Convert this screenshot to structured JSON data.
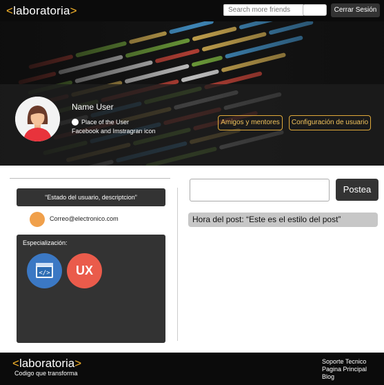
{
  "header": {
    "logo_open": "<",
    "logo_text": "laboratoria",
    "logo_close": ">",
    "search_placeholder": "Search more friends",
    "logout_label": "Cerrar Sesión"
  },
  "profile": {
    "name": "Name User",
    "place": "Place of the User",
    "social": "Facebook and Imstragran icon",
    "friends_button": "Amigos y mentores",
    "settings_button": "Configuración de usuario"
  },
  "sidebar": {
    "status": "“Estado del usuario, descriptcion”",
    "email": "Correo@electronico.com",
    "specialization_title": "Especialización:",
    "specializations": [
      "code-icon",
      "ux-icon"
    ],
    "ux_label": "UX"
  },
  "feed": {
    "post_button": "Postea",
    "post_text": "Hora del post: “Este es el estilo del post”"
  },
  "footer": {
    "logo_open": "<",
    "logo_text": "laboratoria",
    "logo_close": ">",
    "tagline": "Codigo que transforma",
    "links": [
      "Soporte Tecnico",
      "Pagina Principal",
      "Blog"
    ]
  },
  "colors": {
    "accent": "#f7b52b",
    "dark": "#333333",
    "outline_button": "#e0a93a"
  }
}
